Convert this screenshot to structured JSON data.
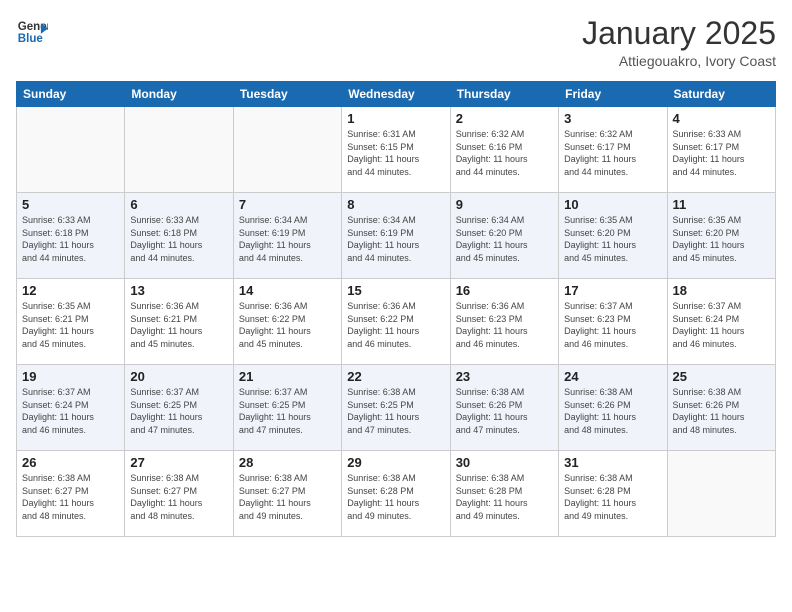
{
  "logo": {
    "line1": "General",
    "line2": "Blue"
  },
  "title": "January 2025",
  "location": "Attiegouakro, Ivory Coast",
  "days_of_week": [
    "Sunday",
    "Monday",
    "Tuesday",
    "Wednesday",
    "Thursday",
    "Friday",
    "Saturday"
  ],
  "weeks": [
    [
      {
        "day": "",
        "info": ""
      },
      {
        "day": "",
        "info": ""
      },
      {
        "day": "",
        "info": ""
      },
      {
        "day": "1",
        "info": "Sunrise: 6:31 AM\nSunset: 6:15 PM\nDaylight: 11 hours\nand 44 minutes."
      },
      {
        "day": "2",
        "info": "Sunrise: 6:32 AM\nSunset: 6:16 PM\nDaylight: 11 hours\nand 44 minutes."
      },
      {
        "day": "3",
        "info": "Sunrise: 6:32 AM\nSunset: 6:17 PM\nDaylight: 11 hours\nand 44 minutes."
      },
      {
        "day": "4",
        "info": "Sunrise: 6:33 AM\nSunset: 6:17 PM\nDaylight: 11 hours\nand 44 minutes."
      }
    ],
    [
      {
        "day": "5",
        "info": "Sunrise: 6:33 AM\nSunset: 6:18 PM\nDaylight: 11 hours\nand 44 minutes."
      },
      {
        "day": "6",
        "info": "Sunrise: 6:33 AM\nSunset: 6:18 PM\nDaylight: 11 hours\nand 44 minutes."
      },
      {
        "day": "7",
        "info": "Sunrise: 6:34 AM\nSunset: 6:19 PM\nDaylight: 11 hours\nand 44 minutes."
      },
      {
        "day": "8",
        "info": "Sunrise: 6:34 AM\nSunset: 6:19 PM\nDaylight: 11 hours\nand 44 minutes."
      },
      {
        "day": "9",
        "info": "Sunrise: 6:34 AM\nSunset: 6:20 PM\nDaylight: 11 hours\nand 45 minutes."
      },
      {
        "day": "10",
        "info": "Sunrise: 6:35 AM\nSunset: 6:20 PM\nDaylight: 11 hours\nand 45 minutes."
      },
      {
        "day": "11",
        "info": "Sunrise: 6:35 AM\nSunset: 6:20 PM\nDaylight: 11 hours\nand 45 minutes."
      }
    ],
    [
      {
        "day": "12",
        "info": "Sunrise: 6:35 AM\nSunset: 6:21 PM\nDaylight: 11 hours\nand 45 minutes."
      },
      {
        "day": "13",
        "info": "Sunrise: 6:36 AM\nSunset: 6:21 PM\nDaylight: 11 hours\nand 45 minutes."
      },
      {
        "day": "14",
        "info": "Sunrise: 6:36 AM\nSunset: 6:22 PM\nDaylight: 11 hours\nand 45 minutes."
      },
      {
        "day": "15",
        "info": "Sunrise: 6:36 AM\nSunset: 6:22 PM\nDaylight: 11 hours\nand 46 minutes."
      },
      {
        "day": "16",
        "info": "Sunrise: 6:36 AM\nSunset: 6:23 PM\nDaylight: 11 hours\nand 46 minutes."
      },
      {
        "day": "17",
        "info": "Sunrise: 6:37 AM\nSunset: 6:23 PM\nDaylight: 11 hours\nand 46 minutes."
      },
      {
        "day": "18",
        "info": "Sunrise: 6:37 AM\nSunset: 6:24 PM\nDaylight: 11 hours\nand 46 minutes."
      }
    ],
    [
      {
        "day": "19",
        "info": "Sunrise: 6:37 AM\nSunset: 6:24 PM\nDaylight: 11 hours\nand 46 minutes."
      },
      {
        "day": "20",
        "info": "Sunrise: 6:37 AM\nSunset: 6:25 PM\nDaylight: 11 hours\nand 47 minutes."
      },
      {
        "day": "21",
        "info": "Sunrise: 6:37 AM\nSunset: 6:25 PM\nDaylight: 11 hours\nand 47 minutes."
      },
      {
        "day": "22",
        "info": "Sunrise: 6:38 AM\nSunset: 6:25 PM\nDaylight: 11 hours\nand 47 minutes."
      },
      {
        "day": "23",
        "info": "Sunrise: 6:38 AM\nSunset: 6:26 PM\nDaylight: 11 hours\nand 47 minutes."
      },
      {
        "day": "24",
        "info": "Sunrise: 6:38 AM\nSunset: 6:26 PM\nDaylight: 11 hours\nand 48 minutes."
      },
      {
        "day": "25",
        "info": "Sunrise: 6:38 AM\nSunset: 6:26 PM\nDaylight: 11 hours\nand 48 minutes."
      }
    ],
    [
      {
        "day": "26",
        "info": "Sunrise: 6:38 AM\nSunset: 6:27 PM\nDaylight: 11 hours\nand 48 minutes."
      },
      {
        "day": "27",
        "info": "Sunrise: 6:38 AM\nSunset: 6:27 PM\nDaylight: 11 hours\nand 48 minutes."
      },
      {
        "day": "28",
        "info": "Sunrise: 6:38 AM\nSunset: 6:27 PM\nDaylight: 11 hours\nand 49 minutes."
      },
      {
        "day": "29",
        "info": "Sunrise: 6:38 AM\nSunset: 6:28 PM\nDaylight: 11 hours\nand 49 minutes."
      },
      {
        "day": "30",
        "info": "Sunrise: 6:38 AM\nSunset: 6:28 PM\nDaylight: 11 hours\nand 49 minutes."
      },
      {
        "day": "31",
        "info": "Sunrise: 6:38 AM\nSunset: 6:28 PM\nDaylight: 11 hours\nand 49 minutes."
      },
      {
        "day": "",
        "info": ""
      }
    ]
  ]
}
